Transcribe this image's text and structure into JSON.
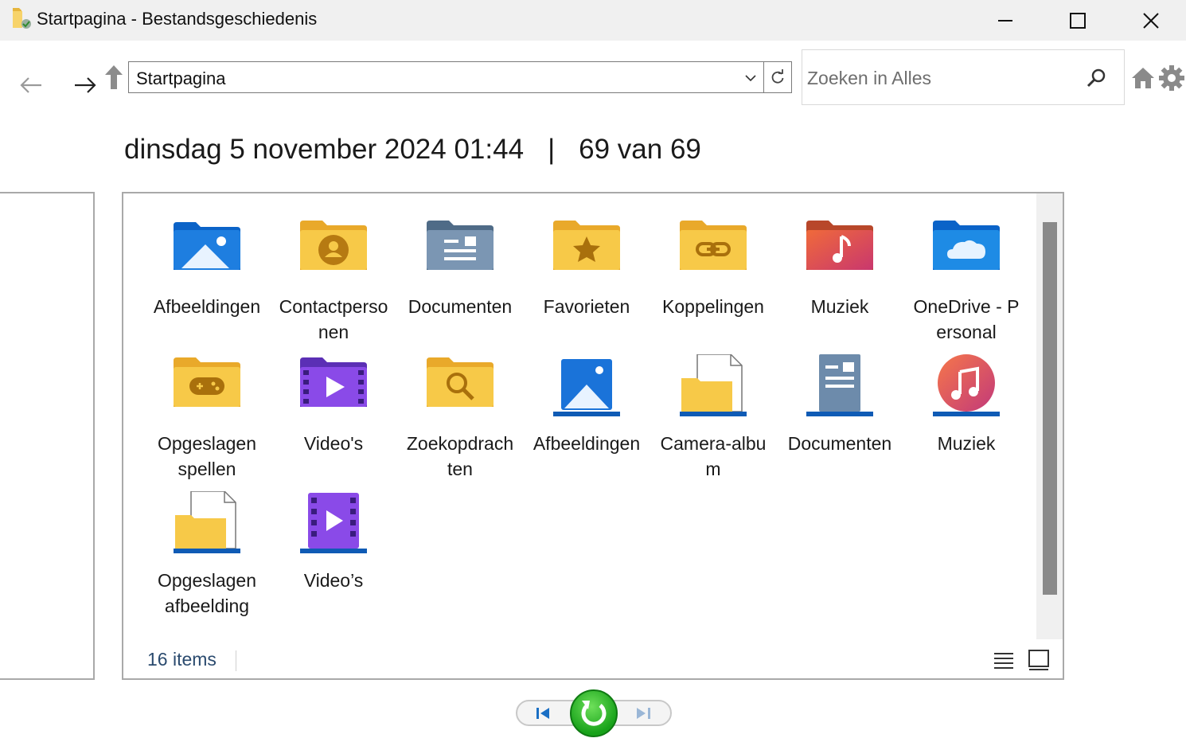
{
  "window": {
    "title": "Startpagina - Bestandsgeschiedenis",
    "controls": [
      "minimize-icon",
      "maximize-icon",
      "close-icon"
    ]
  },
  "nav": {
    "address": "Startpagina",
    "search_placeholder": "Zoeken in Alles"
  },
  "header": {
    "datetime": "dinsdag 5 november 2024 01:44",
    "separator": "|",
    "position": "69 van 69"
  },
  "items": [
    {
      "label": "Afbeeldingen",
      "icon": "pictures-folder-icon"
    },
    {
      "label": "Contactpersonen",
      "icon": "contacts-folder-icon"
    },
    {
      "label": "Documenten",
      "icon": "documents-folder-icon"
    },
    {
      "label": "Favorieten",
      "icon": "favorites-folder-icon"
    },
    {
      "label": "Koppelingen",
      "icon": "links-folder-icon"
    },
    {
      "label": "Muziek",
      "icon": "music-folder-icon"
    },
    {
      "label": "OneDrive - Personal",
      "icon": "onedrive-folder-icon"
    },
    {
      "label": "Opgeslagen spellen",
      "icon": "saved-games-folder-icon"
    },
    {
      "label": "Video's",
      "icon": "videos-folder-icon"
    },
    {
      "label": "Zoekopdrachten",
      "icon": "searches-folder-icon"
    },
    {
      "label": "Afbeeldingen",
      "icon": "pictures-library-icon"
    },
    {
      "label": "Camera-album",
      "icon": "camera-roll-icon"
    },
    {
      "label": "Documenten",
      "icon": "documents-library-icon"
    },
    {
      "label": "Muziek",
      "icon": "music-library-icon"
    },
    {
      "label": "Opgeslagen afbeelding",
      "icon": "saved-pictures-icon"
    },
    {
      "label": "Video’s",
      "icon": "videos-library-icon"
    }
  ],
  "status": {
    "count": "16 items"
  },
  "colors": {
    "folder_yellow": "#f7c948",
    "accent_blue": "#1a73d9",
    "play_green": "#1fae1f"
  }
}
